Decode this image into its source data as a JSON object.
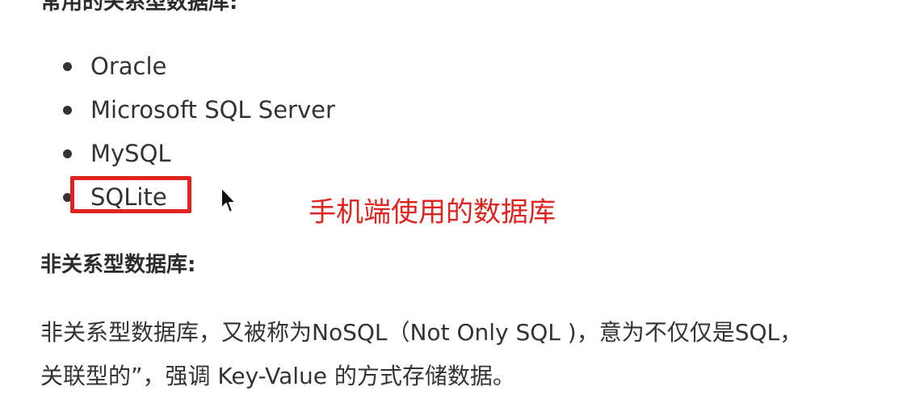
{
  "sections": {
    "relational_heading": "常用的关系型数据库:",
    "relational_items": [
      "Oracle",
      "Microsoft SQL Server",
      "MySQL",
      "SQLite"
    ],
    "nosql_heading": "非关系型数据库:",
    "nosql_paragraph": [
      "非关系型数据库，又被称为NoSQL（Not Only SQL )，意为不仅仅是SQL，",
      "关联型的”，强调 Key-Value 的方式存储数据。"
    ]
  },
  "annotation": {
    "text": "手机端使用的数据库",
    "color": "#e0231e"
  },
  "icons": {
    "cursor": "mouse-pointer-icon"
  }
}
